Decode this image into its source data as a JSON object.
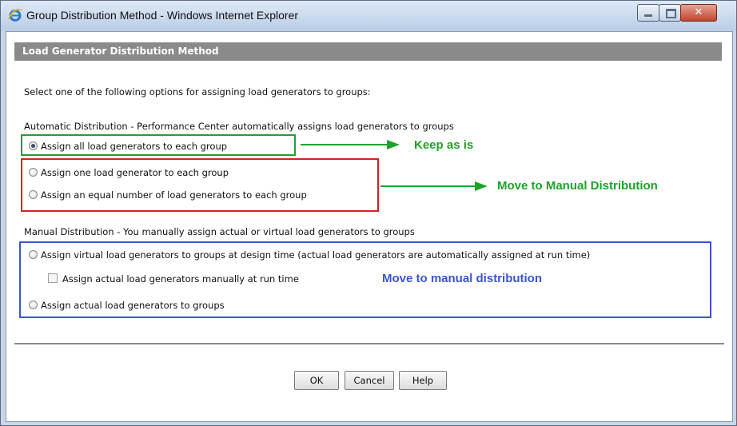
{
  "window": {
    "title": "Group Distribution Method - Windows Internet Explorer",
    "controls": {
      "minimize": "minimize-icon",
      "maximize": "maximize-icon",
      "close": "close-icon"
    }
  },
  "dialog": {
    "header": "Load Generator Distribution Method",
    "instruction": "Select one of the following options for assigning load generators to groups:",
    "automatic": {
      "heading": "Automatic Distribution - Performance Center automatically assigns load generators to groups",
      "options": [
        {
          "label": "Assign all load generators to each group",
          "checked": true
        },
        {
          "label": "Assign one load generator to each group",
          "checked": false
        },
        {
          "label": "Assign an equal number of load generators to each group",
          "checked": false
        }
      ]
    },
    "manual": {
      "heading": "Manual Distribution - You manually assign actual or virtual load generators to groups",
      "options": [
        {
          "label": "Assign virtual load generators to groups at design time (actual load generators are automatically assigned at run time)",
          "checked": false
        },
        {
          "label": "Assign actual load generators to groups",
          "checked": false
        }
      ],
      "checkbox": {
        "label": "Assign actual load generators manually at run time",
        "checked": false
      }
    },
    "buttons": {
      "ok": "OK",
      "cancel": "Cancel",
      "help": "Help"
    }
  },
  "annotations": {
    "keep": "Keep as is",
    "move_manual": "Move to Manual Distribution",
    "move_manual_lower": "Move to manual distribution"
  },
  "colors": {
    "green": "#1ea32a",
    "red": "#d42020",
    "blue": "#3a55d6",
    "header_bg": "#8a8a8a"
  }
}
